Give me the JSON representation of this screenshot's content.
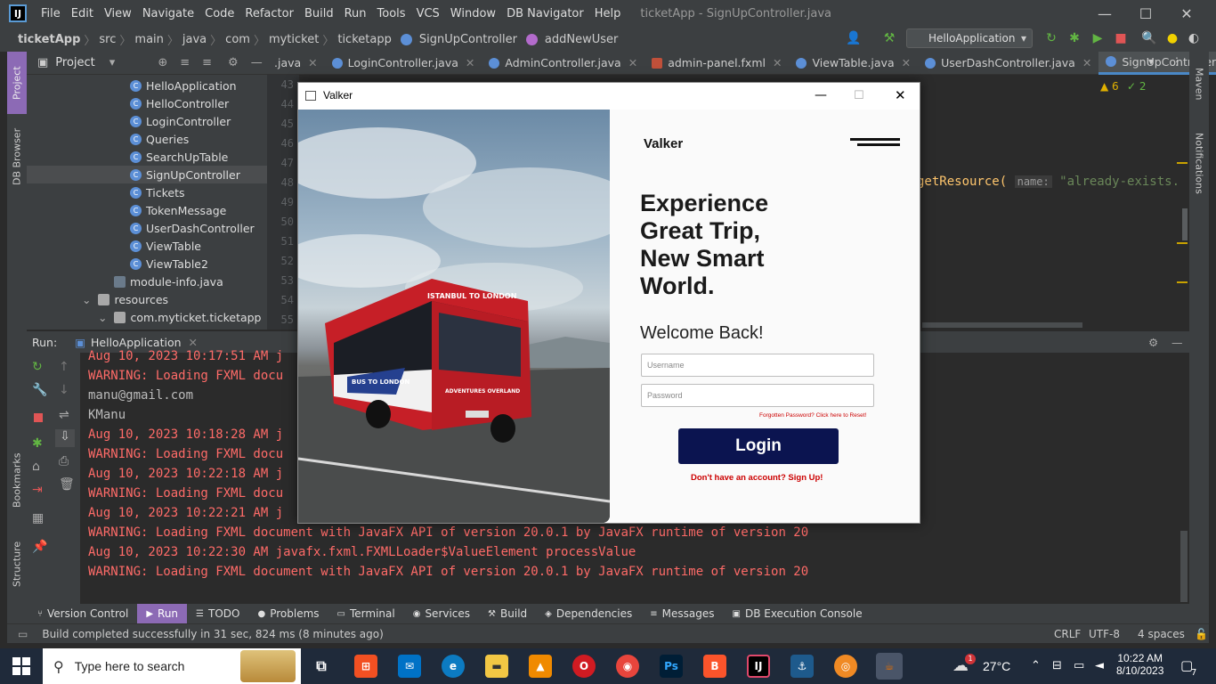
{
  "menubar": {
    "items": [
      "File",
      "Edit",
      "View",
      "Navigate",
      "Code",
      "Refactor",
      "Build",
      "Run",
      "Tools",
      "VCS",
      "Window",
      "DB Navigator",
      "Help"
    ],
    "window_title": "ticketApp - SignUpController.java"
  },
  "breadcrumb": [
    "ticketApp",
    "src",
    "main",
    "java",
    "com",
    "myticket",
    "ticketapp",
    "SignUpController",
    "addNewUser"
  ],
  "run_config": "HelloApplication",
  "project_panel": {
    "title": "Project",
    "items": [
      {
        "label": "HelloApplication",
        "kind": "class"
      },
      {
        "label": "HelloController",
        "kind": "class"
      },
      {
        "label": "LoginController",
        "kind": "class"
      },
      {
        "label": "Queries",
        "kind": "class"
      },
      {
        "label": "SearchUpTable",
        "kind": "class"
      },
      {
        "label": "SignUpController",
        "kind": "class",
        "selected": true
      },
      {
        "label": "Tickets",
        "kind": "class"
      },
      {
        "label": "TokenMessage",
        "kind": "class"
      },
      {
        "label": "UserDashController",
        "kind": "class"
      },
      {
        "label": "ViewTable",
        "kind": "class"
      },
      {
        "label": "ViewTable2",
        "kind": "class"
      },
      {
        "label": "module-info.java",
        "kind": "file"
      },
      {
        "label": "resources",
        "kind": "folder"
      },
      {
        "label": "com.myticket.ticketapp",
        "kind": "folder"
      }
    ]
  },
  "line_numbers": [
    "43",
    "44",
    "45",
    "46",
    "47",
    "48",
    "49",
    "50",
    "51",
    "52",
    "53",
    "54",
    "55"
  ],
  "editor_tabs": [
    {
      "label": ".java",
      "active": false
    },
    {
      "label": "LoginController.java",
      "active": false
    },
    {
      "label": "AdminController.java",
      "active": false
    },
    {
      "label": "admin-panel.fxml",
      "active": false
    },
    {
      "label": "ViewTable.java",
      "active": false
    },
    {
      "label": "UserDashController.java",
      "active": false
    },
    {
      "label": "SignUpController.java",
      "active": true
    }
  ],
  "editor": {
    "warnings": "6",
    "ok_count": "2",
    "code_fragment": "getResource(",
    "param_hint": "name:",
    "string_fragment": "\"already-exists."
  },
  "left_strip": {
    "project": "Project",
    "db_browser": "DB Browser",
    "bookmarks": "Bookmarks",
    "structure": "Structure"
  },
  "right_strip": {
    "maven": "Maven",
    "notifications": "Notifications"
  },
  "run_panel": {
    "label": "Run:",
    "config": "HelloApplication"
  },
  "console_lines": [
    {
      "text": "Aug 10, 2023 10:17:51 AM j",
      "style": "red"
    },
    {
      "text": "WARNING: Loading FXML docu",
      "style": "red"
    },
    {
      "text": "manu@gmail.com",
      "style": "gray"
    },
    {
      "text": "KManu",
      "style": "gray"
    },
    {
      "text": "Aug 10, 2023 10:18:28 AM j",
      "style": "red"
    },
    {
      "text": "WARNING: Loading FXML docu",
      "style": "red"
    },
    {
      "text": "Aug 10, 2023 10:22:18 AM j",
      "style": "red"
    },
    {
      "text": "WARNING: Loading FXML docu",
      "style": "red"
    },
    {
      "text": "Aug 10, 2023 10:22:21 AM j",
      "style": "red"
    },
    {
      "text": "WARNING: Loading FXML document with JavaFX API of version 20.0.1 by JavaFX runtime of version 20",
      "style": "red"
    },
    {
      "text": "Aug 10, 2023 10:22:30 AM javafx.fxml.FXMLLoader$ValueElement processValue",
      "style": "red"
    },
    {
      "text": "WARNING: Loading FXML document with JavaFX API of version 20.0.1 by JavaFX runtime of version 20",
      "style": "red"
    }
  ],
  "bottom_tabs": [
    "Version Control",
    "Run",
    "TODO",
    "Problems",
    "Terminal",
    "Services",
    "Build",
    "Dependencies",
    "Messages",
    "DB Execution Console"
  ],
  "status": {
    "message": "Build completed successfully in 31 sec, 824 ms (8 minutes ago)",
    "line_sep": "CRLF",
    "encoding": "UTF-8",
    "indent": "4 spaces"
  },
  "dialog": {
    "title": "Valker",
    "brand": "Valker",
    "headline": [
      "Experience",
      "Great Trip,",
      "New Smart",
      "World."
    ],
    "welcome": "Welcome Back!",
    "username_placeholder": "Username",
    "password_placeholder": "Password",
    "forgot": "Forgotten Password? Click here to Reset!",
    "login": "Login",
    "signup": "Don't have an account? Sign Up!",
    "bus_sign": "ISTANBUL TO LONDON",
    "bus_side": "BUS TO LONDON",
    "bus_front": "ADVENTURES OVERLAND"
  },
  "taskbar": {
    "search_placeholder": "Type here to search",
    "temperature": "27°C",
    "time": "10:22 AM",
    "date": "8/10/2023",
    "notif_count": "7",
    "weather_badge": "1"
  },
  "colors": {
    "accent": "#0b1450",
    "signup_red": "#cc0000",
    "console_red": "#ff6b68",
    "ide_bg": "#2b2b2b",
    "panel_bg": "#3c3f41"
  }
}
